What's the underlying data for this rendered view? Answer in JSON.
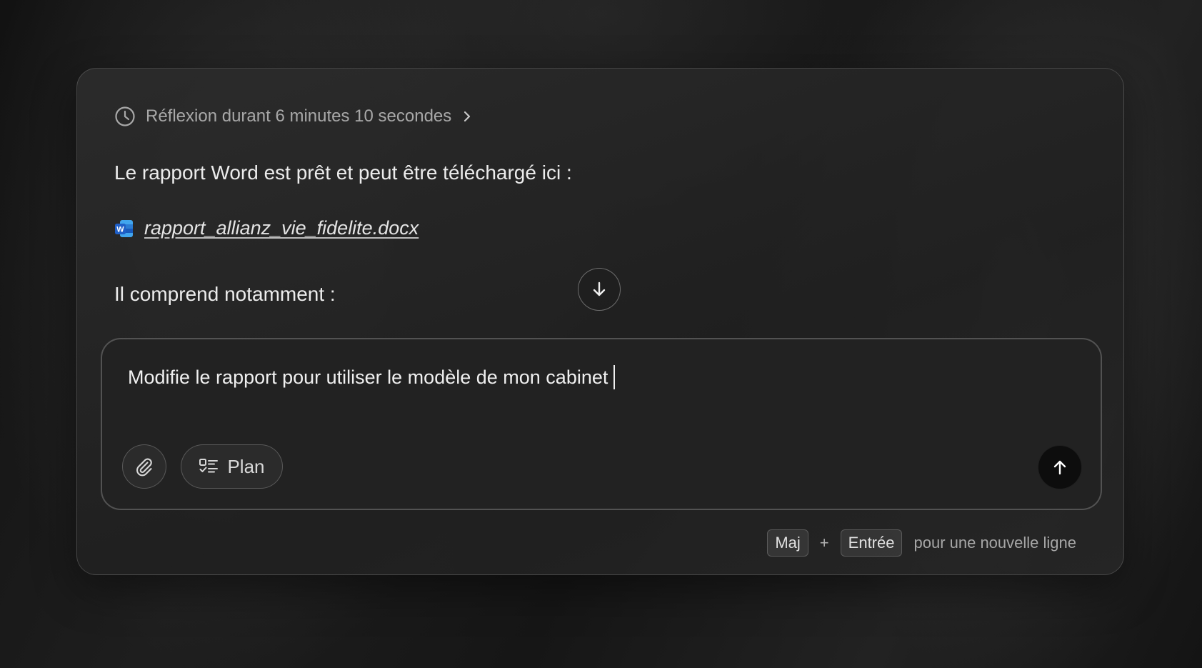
{
  "thinking": {
    "label": "Réflexion durant 6 minutes 10 secondes",
    "icon": "clock-icon",
    "expand_icon": "chevron-right-icon"
  },
  "messages": {
    "intro": "Le rapport Word est prêt et peut être téléchargé ici :",
    "file_name": "rapport_allianz_vie_fidelite.docx",
    "file_icon": "word-doc-icon",
    "details": "Il comprend notamment :"
  },
  "scroll_down": {
    "icon": "arrow-down-icon"
  },
  "composer": {
    "value": "Modifie le rapport pour utiliser le modèle de mon cabinet",
    "attach_icon": "paperclip-icon",
    "plan_label": "Plan",
    "plan_icon": "checklist-icon",
    "send_icon": "arrow-up-icon"
  },
  "hint": {
    "key1": "Maj",
    "plus": "+",
    "key2": "Entrée",
    "text": "pour une nouvelle ligne"
  },
  "colors": {
    "word_blue": "#1f6fde",
    "word_light": "#41a5ee"
  }
}
